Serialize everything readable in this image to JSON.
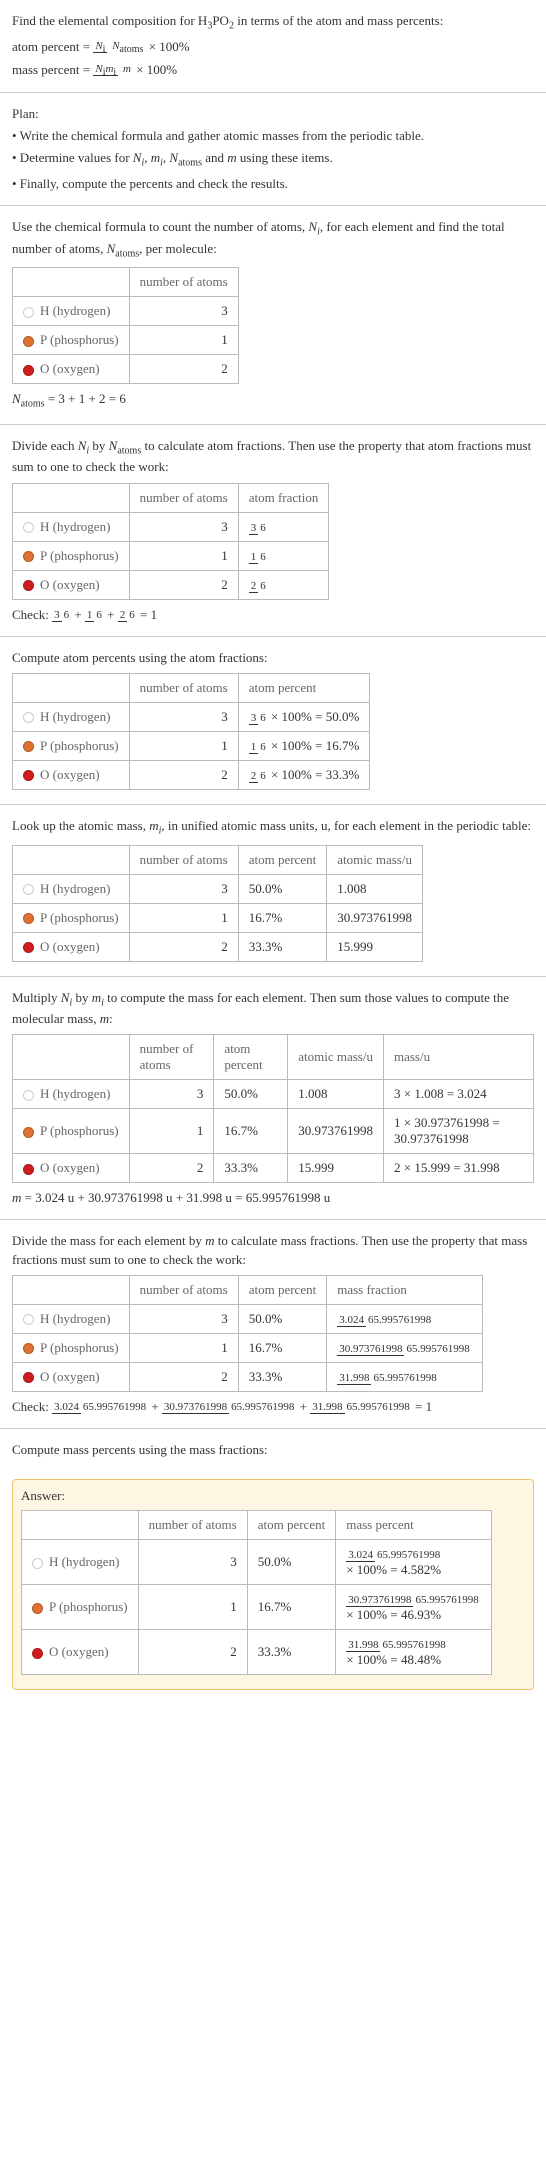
{
  "intro": {
    "line1_a": "Find the elemental composition for H",
    "line1_b": "PO",
    "line1_c": " in terms of the atom and mass percents:",
    "atom_percent_lhs": "atom percent = ",
    "atom_percent_num": "N",
    "atom_percent_num_sub": "i",
    "atom_percent_den": "N",
    "atom_percent_den_sub": "atoms",
    "times100": " × 100%",
    "mass_percent_lhs": "mass percent = ",
    "mass_percent_num_a": "N",
    "mass_percent_num_a_sub": "i",
    "mass_percent_num_b": "m",
    "mass_percent_num_b_sub": "i",
    "mass_percent_den": "m"
  },
  "plan": {
    "title": "Plan:",
    "b1": "• Write the chemical formula and gather atomic masses from the periodic table.",
    "b2_a": "• Determine values for ",
    "b2_b": " using these items.",
    "b3": "• Finally, compute the percents and check the results."
  },
  "count": {
    "p_a": "Use the chemical formula to count the number of atoms, ",
    "p_b": ", for each element and find the total number of atoms, ",
    "p_c": ", per molecule:",
    "h_atoms": "number of atoms",
    "rows": [
      {
        "dot": "#fff",
        "name": "H (hydrogen)",
        "n": "3"
      },
      {
        "dot": "#e07030",
        "name": "P (phosphorus)",
        "n": "1"
      },
      {
        "dot": "#d01c1c",
        "name": "O (oxygen)",
        "n": "2"
      }
    ],
    "sum_a": "N",
    "sum_a_sub": "atoms",
    "sum_b": " = 3 + 1 + 2 = 6"
  },
  "atomfrac": {
    "p_a": "Divide each ",
    "p_b": " by ",
    "p_c": " to calculate atom fractions. Then use the property that atom fractions must sum to one to check the work:",
    "h1": "number of atoms",
    "h2": "atom fraction",
    "rows": [
      {
        "dot": "#fff",
        "name": "H (hydrogen)",
        "n": "3",
        "fn": "3",
        "fd": "6"
      },
      {
        "dot": "#e07030",
        "name": "P (phosphorus)",
        "n": "1",
        "fn": "1",
        "fd": "6"
      },
      {
        "dot": "#d01c1c",
        "name": "O (oxygen)",
        "n": "2",
        "fn": "2",
        "fd": "6"
      }
    ],
    "check_a": "Check: ",
    "check_b": " = 1"
  },
  "atompct": {
    "p": "Compute atom percents using the atom fractions:",
    "h1": "number of atoms",
    "h2": "atom percent",
    "rows": [
      {
        "dot": "#fff",
        "name": "H (hydrogen)",
        "n": "3",
        "fn": "3",
        "fd": "6",
        "pct": " × 100% = 50.0%"
      },
      {
        "dot": "#e07030",
        "name": "P (phosphorus)",
        "n": "1",
        "fn": "1",
        "fd": "6",
        "pct": " × 100% = 16.7%"
      },
      {
        "dot": "#d01c1c",
        "name": "O (oxygen)",
        "n": "2",
        "fn": "2",
        "fd": "6",
        "pct": " × 100% = 33.3%"
      }
    ]
  },
  "atomicmass": {
    "p_a": "Look up the atomic mass, ",
    "p_b": ", in unified atomic mass units, u, for each element in the periodic table:",
    "h1": "number of atoms",
    "h2": "atom percent",
    "h3": "atomic mass/u",
    "rows": [
      {
        "dot": "#fff",
        "name": "H (hydrogen)",
        "n": "3",
        "pct": "50.0%",
        "mass": "1.008"
      },
      {
        "dot": "#e07030",
        "name": "P (phosphorus)",
        "n": "1",
        "pct": "16.7%",
        "mass": "30.973761998"
      },
      {
        "dot": "#d01c1c",
        "name": "O (oxygen)",
        "n": "2",
        "pct": "33.3%",
        "mass": "15.999"
      }
    ]
  },
  "masscalc": {
    "p_a": "Multiply ",
    "p_b": " by ",
    "p_c": " to compute the mass for each element. Then sum those values to compute the molecular mass, ",
    "p_d": ":",
    "h1": "number of atoms",
    "h2": "atom percent",
    "h3": "atomic mass/u",
    "h4": "mass/u",
    "rows": [
      {
        "dot": "#fff",
        "name": "H (hydrogen)",
        "n": "3",
        "pct": "50.0%",
        "mass": "1.008",
        "calc": "3 × 1.008 = 3.024"
      },
      {
        "dot": "#e07030",
        "name": "P (phosphorus)",
        "n": "1",
        "pct": "16.7%",
        "mass": "30.973761998",
        "calc": "1 × 30.973761998 = 30.973761998"
      },
      {
        "dot": "#d01c1c",
        "name": "O (oxygen)",
        "n": "2",
        "pct": "33.3%",
        "mass": "15.999",
        "calc": "2 × 15.999 = 31.998"
      }
    ],
    "sum": "m = 3.024 u + 30.973761998 u + 31.998 u = 65.995761998 u"
  },
  "massfrac": {
    "p_a": "Divide the mass for each element by ",
    "p_b": " to calculate mass fractions. Then use the property that mass fractions must sum to one to check the work:",
    "h1": "number of atoms",
    "h2": "atom percent",
    "h3": "mass fraction",
    "rows": [
      {
        "dot": "#fff",
        "name": "H (hydrogen)",
        "n": "3",
        "pct": "50.0%",
        "fn": "3.024",
        "fd": "65.995761998"
      },
      {
        "dot": "#e07030",
        "name": "P (phosphorus)",
        "n": "1",
        "pct": "16.7%",
        "fn": "30.973761998",
        "fd": "65.995761998"
      },
      {
        "dot": "#d01c1c",
        "name": "O (oxygen)",
        "n": "2",
        "pct": "33.3%",
        "fn": "31.998",
        "fd": "65.995761998"
      }
    ],
    "check_a": "Check: ",
    "check_b": " = 1"
  },
  "masspct": {
    "p": "Compute mass percents using the mass fractions:"
  },
  "answer": {
    "label": "Answer:",
    "h1": "number of atoms",
    "h2": "atom percent",
    "h3": "mass percent",
    "rows": [
      {
        "dot": "#fff",
        "name": "H (hydrogen)",
        "n": "3",
        "pct": "50.0%",
        "fn": "3.024",
        "fd": "65.995761998",
        "res": "× 100% = 4.582%"
      },
      {
        "dot": "#e07030",
        "name": "P (phosphorus)",
        "n": "1",
        "pct": "16.7%",
        "fn": "30.973761998",
        "fd": "65.995761998",
        "res": "× 100% = 46.93%"
      },
      {
        "dot": "#d01c1c",
        "name": "O (oxygen)",
        "n": "2",
        "pct": "33.3%",
        "fn": "31.998",
        "fd": "65.995761998",
        "res": "× 100% = 48.48%"
      }
    ]
  }
}
